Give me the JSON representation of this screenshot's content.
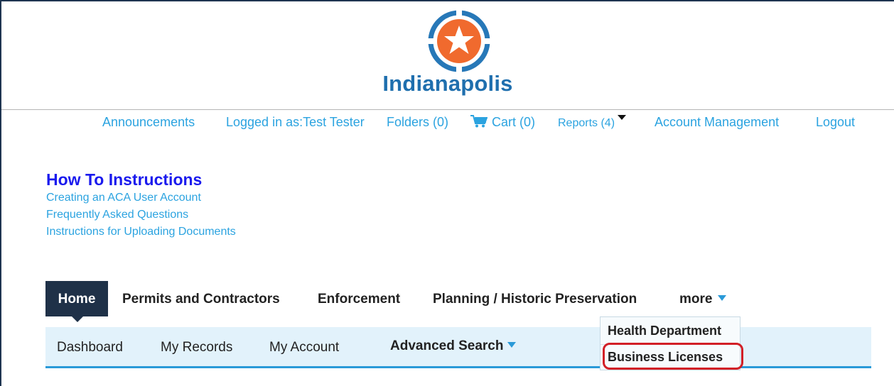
{
  "brand": {
    "name": "Indianapolis",
    "colors": {
      "blue": "#1f6fae",
      "orange": "#f06a2e",
      "ring": "#2778b8"
    },
    "logo_icon": "star-seal-icon"
  },
  "top_links": {
    "announcements": "Announcements",
    "logged_in": "Logged in as:Test Tester",
    "folders": "Folders (0)",
    "cart": "Cart (0)",
    "reports": "Reports (4)",
    "account_management": "Account Management",
    "logout": "Logout"
  },
  "howto": {
    "title": "How To Instructions",
    "links": [
      "Creating an ACA User Account",
      "Frequently Asked Questions",
      "Instructions for Uploading Documents"
    ]
  },
  "main_nav": {
    "home": "Home",
    "permits": "Permits and Contractors",
    "enforcement": "Enforcement",
    "planning": "Planning / Historic Preservation",
    "more": "more"
  },
  "sub_nav": {
    "dashboard": "Dashboard",
    "my_records": "My Records",
    "my_account": "My Account",
    "advanced_search": "Advanced Search"
  },
  "more_menu": {
    "items": [
      "Health Department",
      "Business Licenses"
    ],
    "highlighted": "Business Licenses"
  },
  "colors": {
    "link": "#2ba3e0",
    "howto_title": "#1a1aee",
    "nav_active_bg": "#1f3148",
    "subnav_bg": "#e2f2fb",
    "accent": "#2a9ad8",
    "highlight": "#d21f26"
  }
}
